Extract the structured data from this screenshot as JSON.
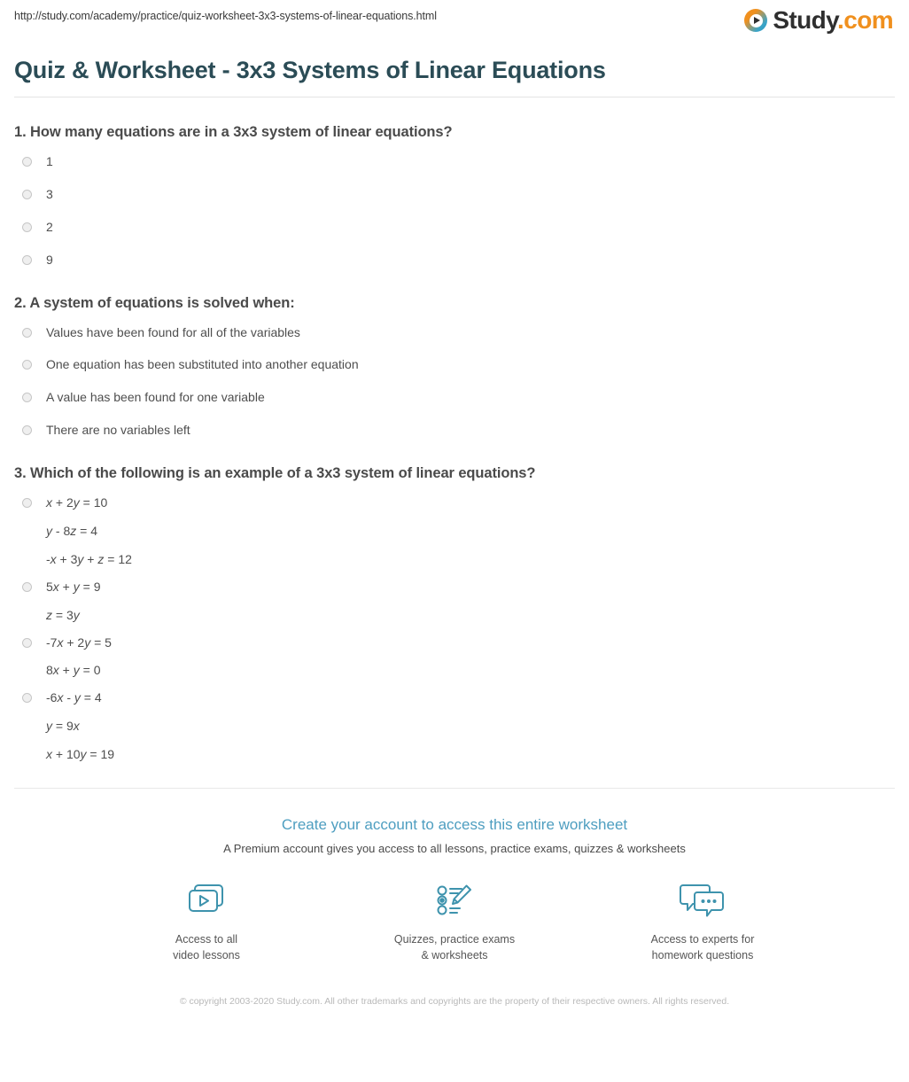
{
  "header": {
    "url": "http://study.com/academy/practice/quiz-worksheet-3x3-systems-of-linear-equations.html",
    "brand_name": "Study",
    "brand_suffix": ".com",
    "brand_icon": "play-circle-icon"
  },
  "title": "Quiz & Worksheet - 3x3 Systems of Linear Equations",
  "questions": [
    {
      "number": "1.",
      "text": "1. How many equations are in a 3x3 system of linear equations?",
      "options": [
        {
          "lines": [
            "1"
          ]
        },
        {
          "lines": [
            "3"
          ]
        },
        {
          "lines": [
            "2"
          ]
        },
        {
          "lines": [
            "9"
          ]
        }
      ]
    },
    {
      "number": "2.",
      "text": "2. A system of equations is solved when:",
      "options": [
        {
          "lines": [
            "Values have been found for all of the variables"
          ]
        },
        {
          "lines": [
            "One equation has been substituted into another equation"
          ]
        },
        {
          "lines": [
            "A value has been found for one variable"
          ]
        },
        {
          "lines": [
            "There are no variables left"
          ]
        }
      ]
    },
    {
      "number": "3.",
      "text": "3. Which of the following is an example of a 3x3 system of linear equations?",
      "options": [
        {
          "lines": [
            "x + 2y = 10",
            "y - 8z = 4",
            "-x + 3y + z = 12"
          ]
        },
        {
          "lines": [
            "5x + y = 9",
            "z = 3y"
          ]
        },
        {
          "lines": [
            "-7x + 2y = 5",
            "8x + y = 0"
          ]
        },
        {
          "lines": [
            "-6x - y = 4",
            "y = 9x",
            "x + 10y = 19"
          ]
        }
      ]
    }
  ],
  "promo": {
    "headline": "Create your account to access this entire worksheet",
    "subtext": "A Premium account gives you access to all lessons, practice exams, quizzes & worksheets",
    "features": [
      {
        "icon": "video-lessons-icon",
        "caption_line1": "Access to all",
        "caption_line2": "video lessons"
      },
      {
        "icon": "quiz-pencil-icon",
        "caption_line1": "Quizzes, practice exams",
        "caption_line2": "& worksheets"
      },
      {
        "icon": "chat-bubbles-icon",
        "caption_line1": "Access to experts for",
        "caption_line2": "homework questions"
      }
    ]
  },
  "copyright": "© copyright 2003-2020 Study.com. All other trademarks and copyrights are the property of their respective owners. All rights reserved.",
  "colors": {
    "title": "#2b4c56",
    "promo_headline": "#4e9ec0",
    "brand_orange": "#f0901e",
    "brand_blue": "#3aa5c9",
    "icon_teal": "#3e93ad"
  }
}
